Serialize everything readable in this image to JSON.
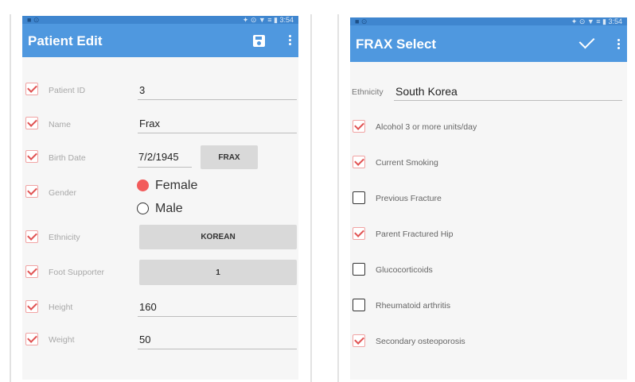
{
  "left": {
    "status_left": "■ ⊙",
    "status_right": "✦ ⊙ ▼ ≡ ▮ 3:54",
    "title": "Patient Edit",
    "fields": [
      {
        "label": "Patient ID",
        "value": "3",
        "checked": true
      },
      {
        "label": "Name",
        "value": "Frax",
        "checked": true
      },
      {
        "label": "Birth Date",
        "value": "7/2/1945",
        "checked": true
      },
      {
        "label": "Gender",
        "value": "",
        "checked": true
      },
      {
        "label": "Ethnicity",
        "value": "KOREAN",
        "checked": true
      },
      {
        "label": "Foot Supporter",
        "value": "1",
        "checked": true
      },
      {
        "label": "Height",
        "value": "160",
        "checked": true
      },
      {
        "label": "Weight",
        "value": "50",
        "checked": true
      }
    ],
    "frax_button": "FRAX",
    "gender_options": [
      {
        "label": "Female",
        "selected": true
      },
      {
        "label": "Male",
        "selected": false
      }
    ],
    "icons": {
      "save": "save-icon",
      "overflow": "more-vert-icon"
    }
  },
  "right": {
    "status_left": "■ ⊙",
    "status_right": "✦ ⊙ ▼ ≡ ▮ 3:54",
    "title": "FRAX Select",
    "ethnicity_label": "Ethnicity",
    "ethnicity_value": "South Korea",
    "options": [
      {
        "label": "Alcohol 3 or more units/day",
        "checked": true
      },
      {
        "label": "Current Smoking",
        "checked": true
      },
      {
        "label": "Previous Fracture",
        "checked": false
      },
      {
        "label": "Parent Fractured Hip",
        "checked": true
      },
      {
        "label": "Glucocorticoids",
        "checked": false
      },
      {
        "label": "Rheumatoid arthritis",
        "checked": false
      },
      {
        "label": "Secondary osteoporosis",
        "checked": true
      }
    ],
    "icons": {
      "confirm": "check-icon",
      "overflow": "more-vert-icon"
    }
  },
  "colors": {
    "appbar": "#4f98df",
    "accent": "#f25b5b",
    "checkbox_border": "#f1a3a3"
  }
}
